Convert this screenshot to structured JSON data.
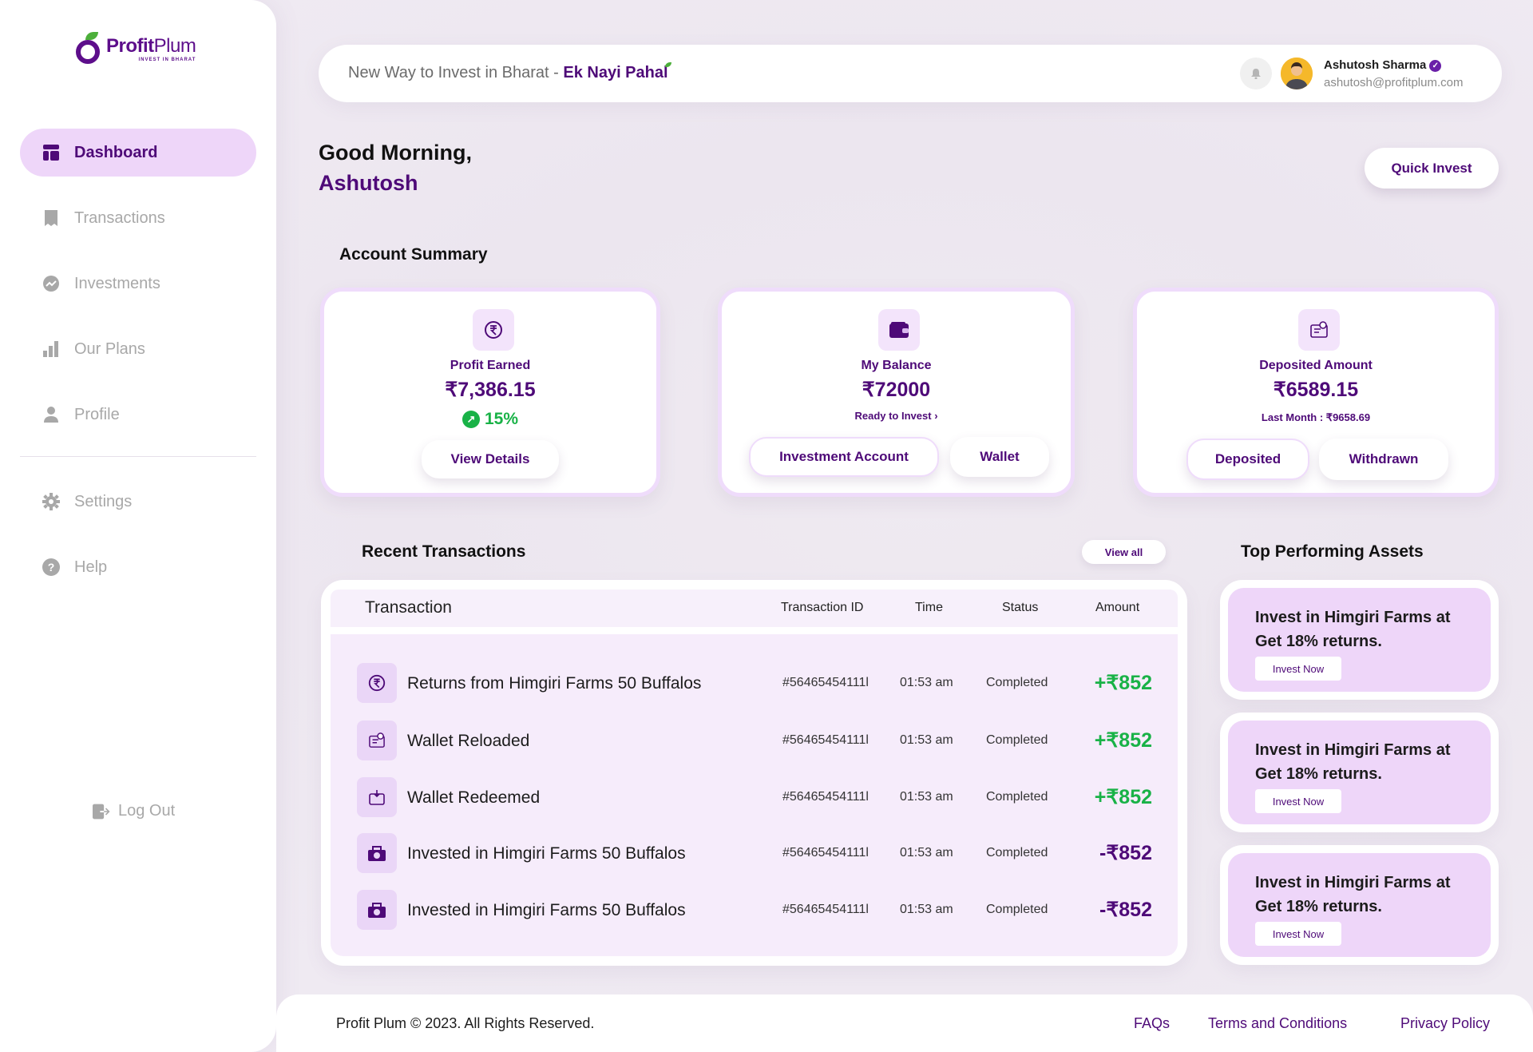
{
  "brand": {
    "name_bold": "Profit",
    "name_light": "Plum",
    "tagline": "INVEST IN BHARAT"
  },
  "sidebar": {
    "items": [
      {
        "label": "Dashboard",
        "icon": "dashboard-icon",
        "active": true
      },
      {
        "label": "Transactions",
        "icon": "receipt-icon",
        "active": false
      },
      {
        "label": "Investments",
        "icon": "trend-icon",
        "active": false
      },
      {
        "label": "Our Plans",
        "icon": "bar-chart-icon",
        "active": false
      },
      {
        "label": "Profile",
        "icon": "user-icon",
        "active": false
      }
    ],
    "secondary": [
      {
        "label": "Settings",
        "icon": "gear-icon"
      },
      {
        "label": "Help",
        "icon": "help-icon"
      }
    ],
    "logout_label": "Log Out"
  },
  "header": {
    "tagline_plain": "New Way to Invest in Bharat - ",
    "tagline_bold": "Ek Nayi Pahal",
    "user_name": "Ashutosh Sharma",
    "user_email": "ashutosh@profitplum.com"
  },
  "greeting": {
    "line1": "Good Morning,",
    "line2": "Ashutosh"
  },
  "quick_invest_label": "Quick Invest",
  "account_summary": {
    "title": "Account Summary",
    "profit": {
      "label": "Profit Earned",
      "value": "₹7,386.15",
      "percent": "15%",
      "button": "View Details"
    },
    "balance": {
      "label": "My Balance",
      "value": "₹72000",
      "sub": "Ready to Invest",
      "button1": "Investment Account",
      "button2": "Wallet"
    },
    "deposited": {
      "label": "Deposited Amount",
      "value": "₹6589.15",
      "sub": "Last Month : ₹9658.69",
      "button1": "Deposited",
      "button2": "Withdrawn"
    }
  },
  "transactions": {
    "title": "Recent Transactions",
    "view_all": "View all",
    "columns": [
      "Transaction",
      "Transaction ID",
      "Time",
      "Status",
      "Amount"
    ],
    "rows": [
      {
        "name": "Returns from Himgiri Farms 50 Buffalos",
        "id": "#56465454111l",
        "time": "01:53 am",
        "status": "Completed",
        "amount": "+₹852",
        "sign": "pos",
        "icon": "rupee-cycle-icon"
      },
      {
        "name": "Wallet Reloaded",
        "id": "#56465454111l",
        "time": "01:53 am",
        "status": "Completed",
        "amount": "+₹852",
        "sign": "pos",
        "icon": "wallet-reload-icon"
      },
      {
        "name": "Wallet Redeemed",
        "id": "#56465454111l",
        "time": "01:53 am",
        "status": "Completed",
        "amount": "+₹852",
        "sign": "pos",
        "icon": "wallet-redeem-icon"
      },
      {
        "name": "Invested in Himgiri Farms 50 Buffalos",
        "id": "#56465454111l",
        "time": "01:53 am",
        "status": "Completed",
        "amount": "-₹852",
        "sign": "neg",
        "icon": "investment-icon"
      },
      {
        "name": "Invested in Himgiri Farms 50 Buffalos",
        "id": "#56465454111l",
        "time": "01:53 am",
        "status": "Completed",
        "amount": "-₹852",
        "sign": "neg",
        "icon": "investment-icon"
      }
    ]
  },
  "assets": {
    "title": "Top Performing Assets",
    "items": [
      {
        "text": "Invest in Himgiri Farms at Get 18% returns.",
        "button": "Invest Now"
      },
      {
        "text": "Invest in Himgiri Farms at Get 18% returns.",
        "button": "Invest Now"
      },
      {
        "text": "Invest in Himgiri Farms at Get 18% returns.",
        "button": "Invest Now"
      }
    ]
  },
  "footer": {
    "copyright": "Profit Plum © 2023. All Rights Reserved.",
    "links": [
      "FAQs",
      "Terms and Conditions",
      "Privacy Policy"
    ]
  },
  "colors": {
    "brand_purple": "#4e0a78",
    "accent_light": "#eed6f9",
    "positive": "#19b247"
  }
}
